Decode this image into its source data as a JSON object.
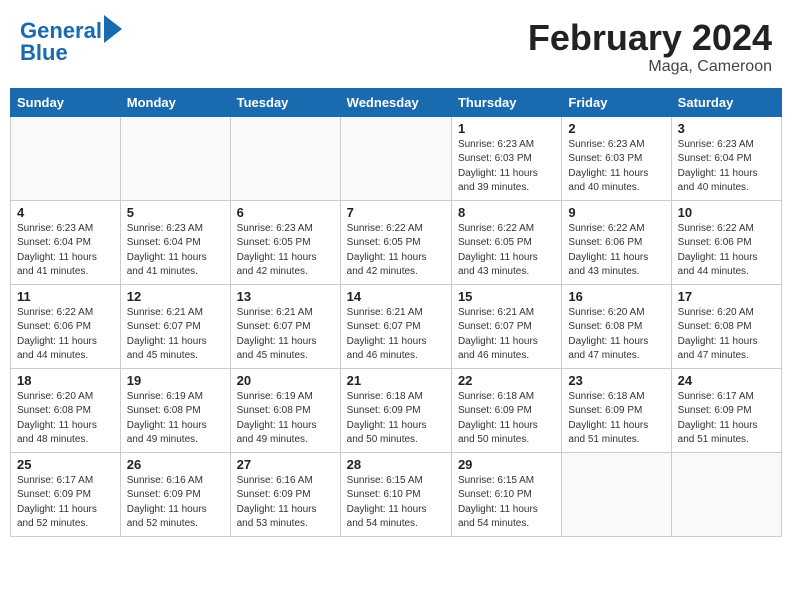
{
  "header": {
    "logo_line1": "General",
    "logo_line2": "Blue",
    "month_year": "February 2024",
    "location": "Maga, Cameroon"
  },
  "days_of_week": [
    "Sunday",
    "Monday",
    "Tuesday",
    "Wednesday",
    "Thursday",
    "Friday",
    "Saturday"
  ],
  "weeks": [
    [
      {
        "num": "",
        "info": ""
      },
      {
        "num": "",
        "info": ""
      },
      {
        "num": "",
        "info": ""
      },
      {
        "num": "",
        "info": ""
      },
      {
        "num": "1",
        "info": "Sunrise: 6:23 AM\nSunset: 6:03 PM\nDaylight: 11 hours\nand 39 minutes."
      },
      {
        "num": "2",
        "info": "Sunrise: 6:23 AM\nSunset: 6:03 PM\nDaylight: 11 hours\nand 40 minutes."
      },
      {
        "num": "3",
        "info": "Sunrise: 6:23 AM\nSunset: 6:04 PM\nDaylight: 11 hours\nand 40 minutes."
      }
    ],
    [
      {
        "num": "4",
        "info": "Sunrise: 6:23 AM\nSunset: 6:04 PM\nDaylight: 11 hours\nand 41 minutes."
      },
      {
        "num": "5",
        "info": "Sunrise: 6:23 AM\nSunset: 6:04 PM\nDaylight: 11 hours\nand 41 minutes."
      },
      {
        "num": "6",
        "info": "Sunrise: 6:23 AM\nSunset: 6:05 PM\nDaylight: 11 hours\nand 42 minutes."
      },
      {
        "num": "7",
        "info": "Sunrise: 6:22 AM\nSunset: 6:05 PM\nDaylight: 11 hours\nand 42 minutes."
      },
      {
        "num": "8",
        "info": "Sunrise: 6:22 AM\nSunset: 6:05 PM\nDaylight: 11 hours\nand 43 minutes."
      },
      {
        "num": "9",
        "info": "Sunrise: 6:22 AM\nSunset: 6:06 PM\nDaylight: 11 hours\nand 43 minutes."
      },
      {
        "num": "10",
        "info": "Sunrise: 6:22 AM\nSunset: 6:06 PM\nDaylight: 11 hours\nand 44 minutes."
      }
    ],
    [
      {
        "num": "11",
        "info": "Sunrise: 6:22 AM\nSunset: 6:06 PM\nDaylight: 11 hours\nand 44 minutes."
      },
      {
        "num": "12",
        "info": "Sunrise: 6:21 AM\nSunset: 6:07 PM\nDaylight: 11 hours\nand 45 minutes."
      },
      {
        "num": "13",
        "info": "Sunrise: 6:21 AM\nSunset: 6:07 PM\nDaylight: 11 hours\nand 45 minutes."
      },
      {
        "num": "14",
        "info": "Sunrise: 6:21 AM\nSunset: 6:07 PM\nDaylight: 11 hours\nand 46 minutes."
      },
      {
        "num": "15",
        "info": "Sunrise: 6:21 AM\nSunset: 6:07 PM\nDaylight: 11 hours\nand 46 minutes."
      },
      {
        "num": "16",
        "info": "Sunrise: 6:20 AM\nSunset: 6:08 PM\nDaylight: 11 hours\nand 47 minutes."
      },
      {
        "num": "17",
        "info": "Sunrise: 6:20 AM\nSunset: 6:08 PM\nDaylight: 11 hours\nand 47 minutes."
      }
    ],
    [
      {
        "num": "18",
        "info": "Sunrise: 6:20 AM\nSunset: 6:08 PM\nDaylight: 11 hours\nand 48 minutes."
      },
      {
        "num": "19",
        "info": "Sunrise: 6:19 AM\nSunset: 6:08 PM\nDaylight: 11 hours\nand 49 minutes."
      },
      {
        "num": "20",
        "info": "Sunrise: 6:19 AM\nSunset: 6:08 PM\nDaylight: 11 hours\nand 49 minutes."
      },
      {
        "num": "21",
        "info": "Sunrise: 6:18 AM\nSunset: 6:09 PM\nDaylight: 11 hours\nand 50 minutes."
      },
      {
        "num": "22",
        "info": "Sunrise: 6:18 AM\nSunset: 6:09 PM\nDaylight: 11 hours\nand 50 minutes."
      },
      {
        "num": "23",
        "info": "Sunrise: 6:18 AM\nSunset: 6:09 PM\nDaylight: 11 hours\nand 51 minutes."
      },
      {
        "num": "24",
        "info": "Sunrise: 6:17 AM\nSunset: 6:09 PM\nDaylight: 11 hours\nand 51 minutes."
      }
    ],
    [
      {
        "num": "25",
        "info": "Sunrise: 6:17 AM\nSunset: 6:09 PM\nDaylight: 11 hours\nand 52 minutes."
      },
      {
        "num": "26",
        "info": "Sunrise: 6:16 AM\nSunset: 6:09 PM\nDaylight: 11 hours\nand 52 minutes."
      },
      {
        "num": "27",
        "info": "Sunrise: 6:16 AM\nSunset: 6:09 PM\nDaylight: 11 hours\nand 53 minutes."
      },
      {
        "num": "28",
        "info": "Sunrise: 6:15 AM\nSunset: 6:10 PM\nDaylight: 11 hours\nand 54 minutes."
      },
      {
        "num": "29",
        "info": "Sunrise: 6:15 AM\nSunset: 6:10 PM\nDaylight: 11 hours\nand 54 minutes."
      },
      {
        "num": "",
        "info": ""
      },
      {
        "num": "",
        "info": ""
      }
    ]
  ]
}
